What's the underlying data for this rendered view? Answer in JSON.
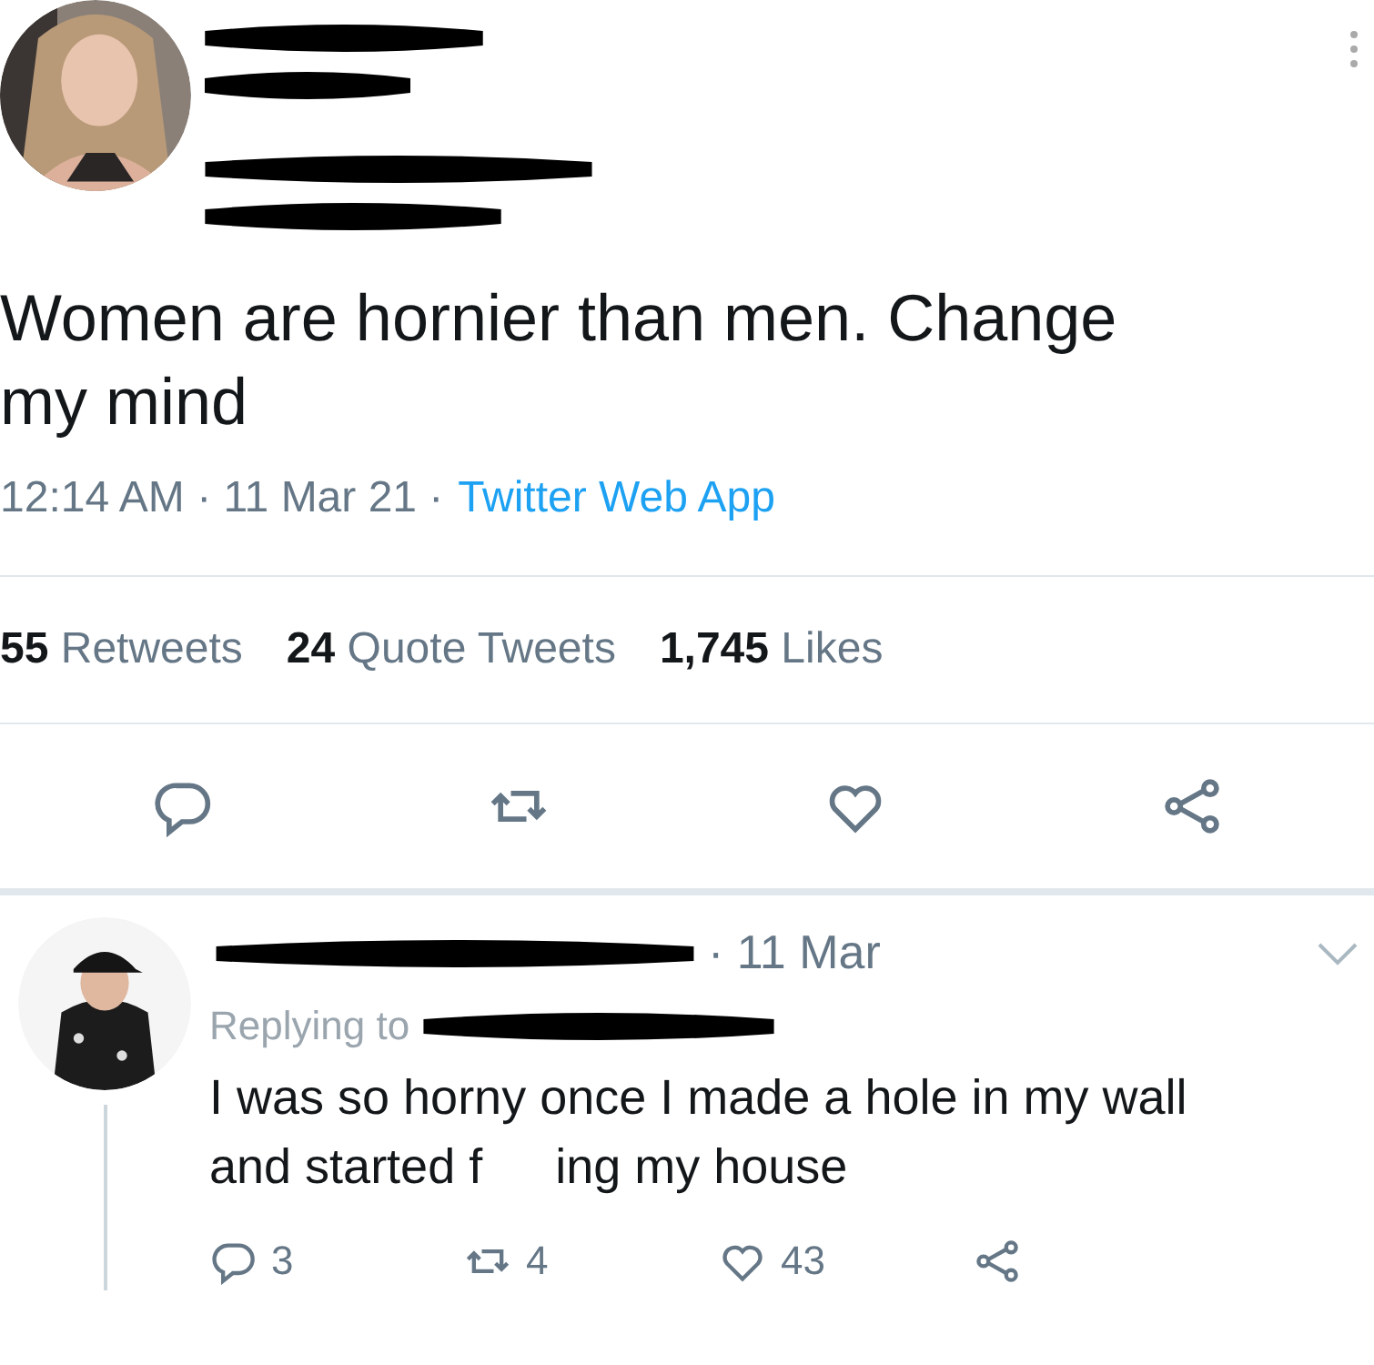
{
  "tweet": {
    "text": "Women are hornier than men. Change my mind",
    "time": "12:14 AM ·",
    "date": "11 Mar 21 ·",
    "source": "Twitter Web App",
    "stats": [
      {
        "count": "55",
        "label": "Retweets"
      },
      {
        "count": "24",
        "label": "Quote Tweets"
      },
      {
        "count": "1,745",
        "label": "Likes"
      }
    ]
  },
  "reply": {
    "date": "· 11 Mar",
    "replying_label": "Replying to",
    "text_before": "I was so horny once I made a hole in my wall and started f",
    "text_after": "ing my house",
    "actions": [
      {
        "kind": "reply",
        "count": "3"
      },
      {
        "kind": "retweet",
        "count": "4"
      },
      {
        "kind": "like",
        "count": "43"
      },
      {
        "kind": "share"
      }
    ]
  }
}
